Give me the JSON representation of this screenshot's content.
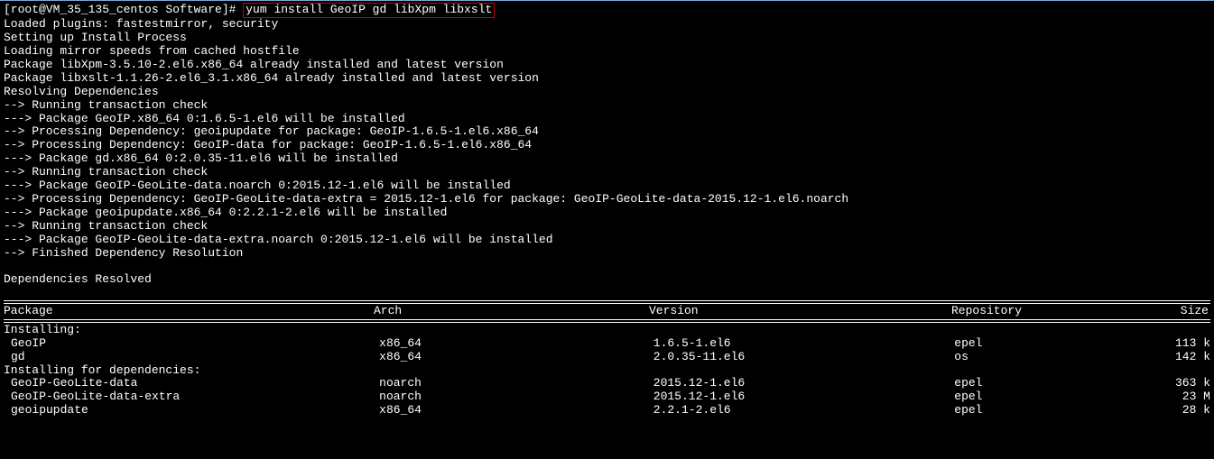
{
  "prompt": {
    "user_host": "[root@VM_35_135_centos Software]# ",
    "command": "yum install GeoIP gd libXpm libxslt"
  },
  "output_lines": [
    "Loaded plugins: fastestmirror, security",
    "Setting up Install Process",
    "Loading mirror speeds from cached hostfile",
    "Package libXpm-3.5.10-2.el6.x86_64 already installed and latest version",
    "Package libxslt-1.1.26-2.el6_3.1.x86_64 already installed and latest version",
    "Resolving Dependencies",
    "--> Running transaction check",
    "---> Package GeoIP.x86_64 0:1.6.5-1.el6 will be installed",
    "--> Processing Dependency: geoipupdate for package: GeoIP-1.6.5-1.el6.x86_64",
    "--> Processing Dependency: GeoIP-data for package: GeoIP-1.6.5-1.el6.x86_64",
    "---> Package gd.x86_64 0:2.0.35-11.el6 will be installed",
    "--> Running transaction check",
    "---> Package GeoIP-GeoLite-data.noarch 0:2015.12-1.el6 will be installed",
    "--> Processing Dependency: GeoIP-GeoLite-data-extra = 2015.12-1.el6 for package: GeoIP-GeoLite-data-2015.12-1.el6.noarch",
    "---> Package geoipupdate.x86_64 0:2.2.1-2.el6 will be installed",
    "--> Running transaction check",
    "---> Package GeoIP-GeoLite-data-extra.noarch 0:2015.12-1.el6 will be installed",
    "--> Finished Dependency Resolution"
  ],
  "deps_resolved": "Dependencies Resolved",
  "table": {
    "headers": {
      "package": "Package",
      "arch": "Arch",
      "version": "Version",
      "repository": "Repository",
      "size": "Size"
    },
    "section_installing": "Installing:",
    "installing": [
      {
        "package": "GeoIP",
        "arch": "x86_64",
        "version": "1.6.5-1.el6",
        "repository": "epel",
        "size": "113 k"
      },
      {
        "package": "gd",
        "arch": "x86_64",
        "version": "2.0.35-11.el6",
        "repository": "os",
        "size": "142 k"
      }
    ],
    "section_deps": "Installing for dependencies:",
    "deps": [
      {
        "package": "GeoIP-GeoLite-data",
        "arch": "noarch",
        "version": "2015.12-1.el6",
        "repository": "epel",
        "size": "363 k"
      },
      {
        "package": "GeoIP-GeoLite-data-extra",
        "arch": "noarch",
        "version": "2015.12-1.el6",
        "repository": "epel",
        "size": "23 M"
      },
      {
        "package": "geoipupdate",
        "arch": "x86_64",
        "version": "2.2.1-2.el6",
        "repository": "epel",
        "size": "28 k"
      }
    ]
  }
}
